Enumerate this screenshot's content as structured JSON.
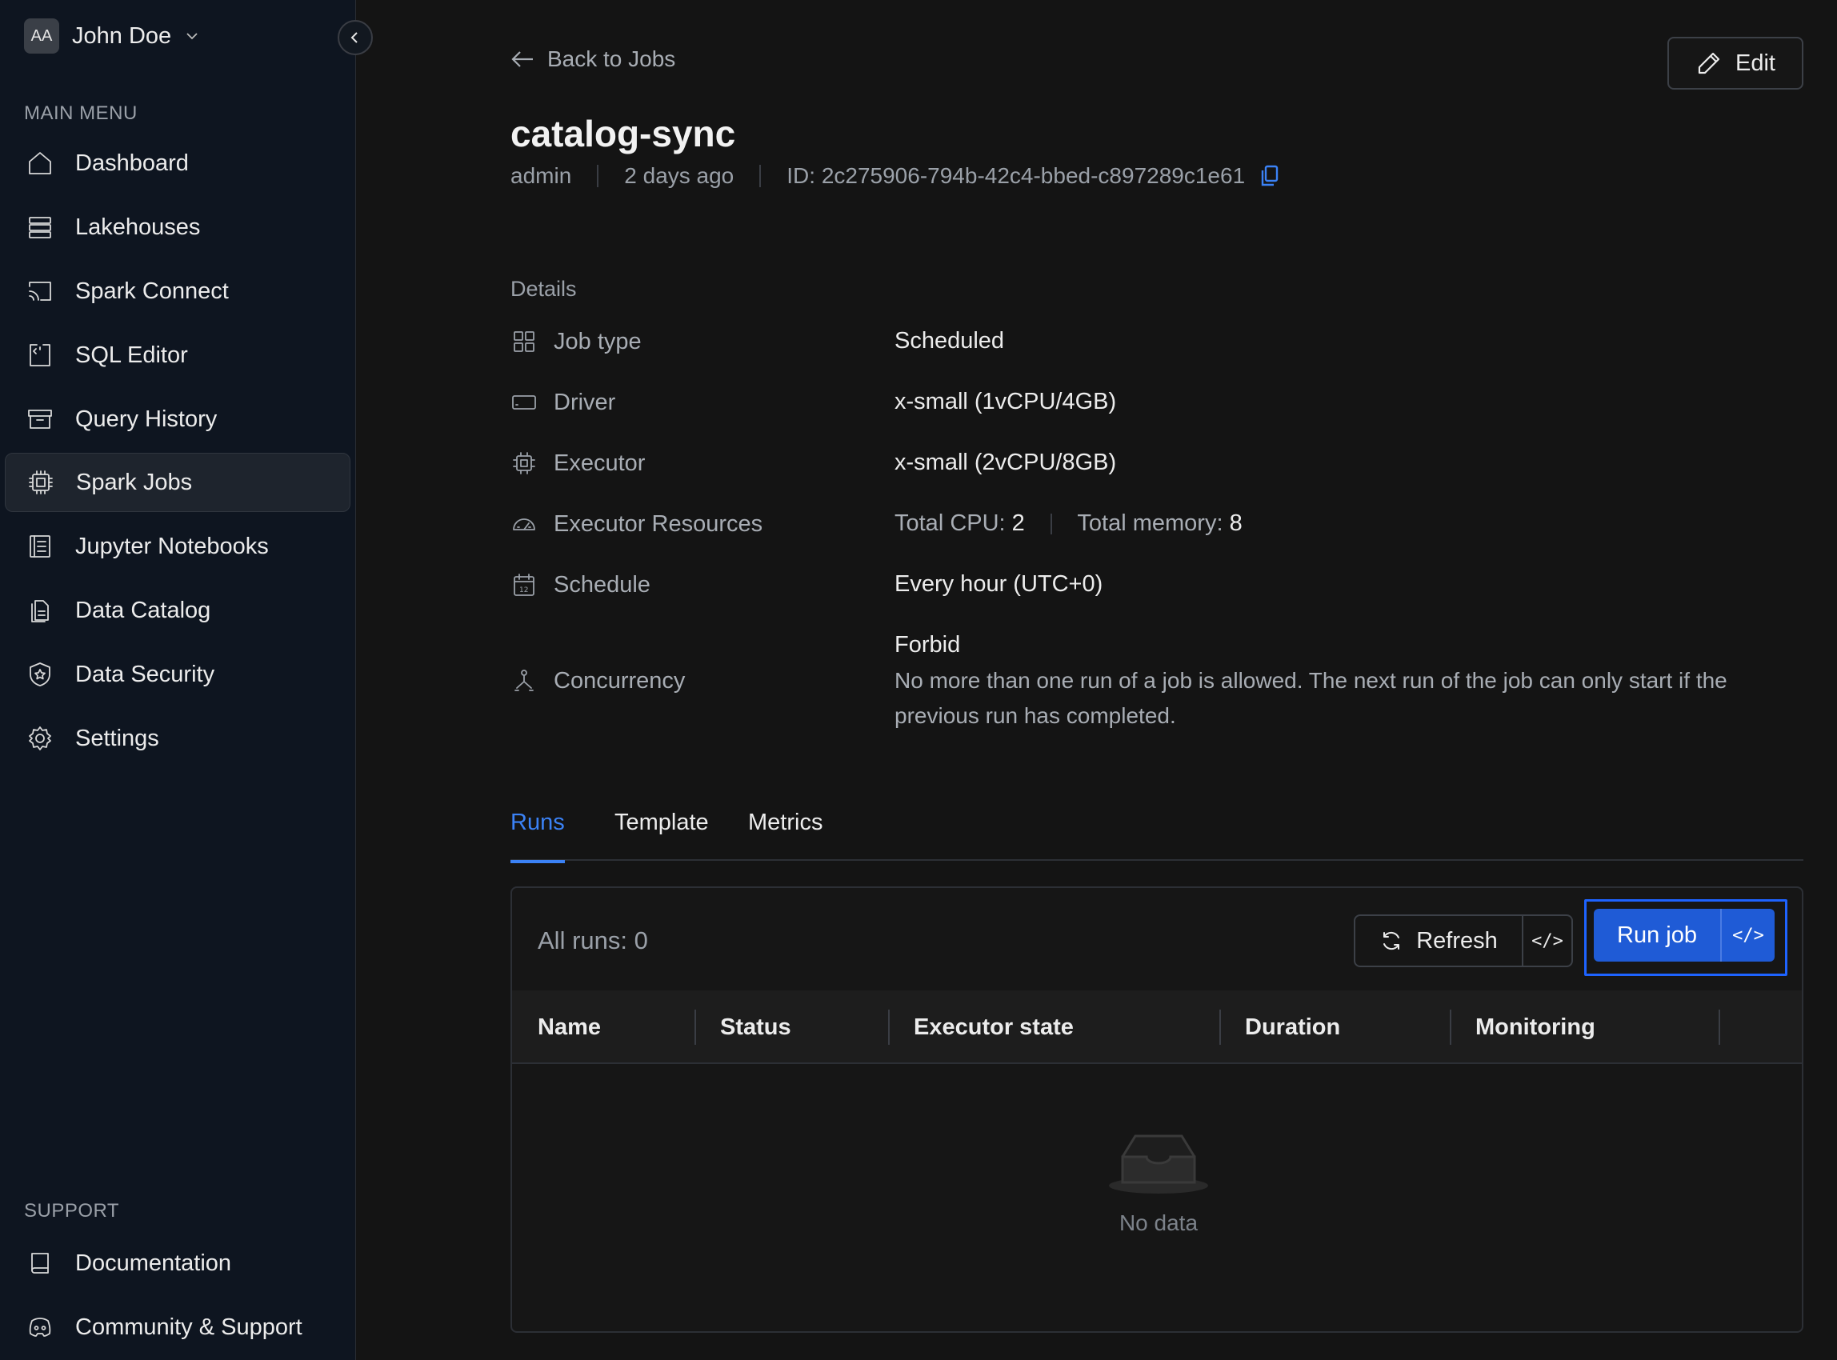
{
  "user": {
    "initials": "AA",
    "name": "John Doe"
  },
  "sidebar": {
    "main_menu_label": "MAIN MENU",
    "items": [
      {
        "label": "Dashboard",
        "icon": "home-icon"
      },
      {
        "label": "Lakehouses",
        "icon": "server-icon"
      },
      {
        "label": "Spark Connect",
        "icon": "cast-icon"
      },
      {
        "label": "SQL Editor",
        "icon": "code-file-icon"
      },
      {
        "label": "Query History",
        "icon": "archive-icon"
      },
      {
        "label": "Spark Jobs",
        "icon": "cpu-icon",
        "active": true
      },
      {
        "label": "Jupyter Notebooks",
        "icon": "notebook-icon"
      },
      {
        "label": "Data Catalog",
        "icon": "files-icon"
      },
      {
        "label": "Data Security",
        "icon": "shield-star-icon"
      },
      {
        "label": "Settings",
        "icon": "gear-icon"
      }
    ],
    "support_label": "SUPPORT",
    "support_items": [
      {
        "label": "Documentation",
        "icon": "book-icon"
      },
      {
        "label": "Community & Support",
        "icon": "discord-icon"
      }
    ]
  },
  "header": {
    "back_label": "Back to Jobs",
    "edit_label": "Edit",
    "title": "catalog-sync",
    "owner": "admin",
    "created": "2 days ago",
    "id_text": "ID: 2c275906-794b-42c4-bbed-c897289c1e61"
  },
  "details": {
    "label": "Details",
    "job_type": {
      "key": "Job type",
      "value": "Scheduled"
    },
    "driver": {
      "key": "Driver",
      "value": "x-small (1vCPU/4GB)"
    },
    "executor": {
      "key": "Executor",
      "value": "x-small (2vCPU/8GB)"
    },
    "executor_resources": {
      "key": "Executor Resources",
      "cpu_label": "Total CPU:",
      "cpu_value": "2",
      "mem_label": "Total memory:",
      "mem_value": "8"
    },
    "schedule": {
      "key": "Schedule",
      "value": "Every hour (UTC+0)"
    },
    "concurrency": {
      "key": "Concurrency",
      "value": "Forbid",
      "description": "No more than one run of a job is allowed. The next run of the job can only start if the previous run has completed."
    }
  },
  "tabs": [
    {
      "label": "Runs",
      "active": true
    },
    {
      "label": "Template"
    },
    {
      "label": "Metrics"
    }
  ],
  "runs": {
    "count_label": "All runs: 0",
    "refresh_label": "Refresh",
    "code_glyph": "</>",
    "run_label": "Run job",
    "columns": [
      "Name",
      "Status",
      "Executor state",
      "Duration",
      "Monitoring"
    ],
    "empty_text": "No data"
  },
  "colors": {
    "accent": "#3b82f6",
    "primary_button": "#1f5bd6",
    "focus_ring": "#1e63ff"
  }
}
